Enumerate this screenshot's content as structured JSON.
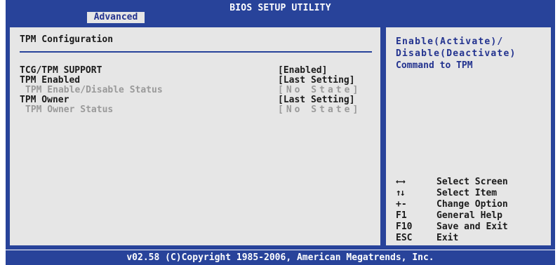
{
  "header": {
    "title": "BIOS SETUP UTILITY",
    "active_tab": "Advanced"
  },
  "main": {
    "section_title": "TPM Configuration",
    "items": [
      {
        "label": "TCG/TPM SUPPORT",
        "value": "[Enabled]",
        "dim": false
      },
      {
        "label": "TPM Enabled",
        "value": "[Last Setting]",
        "dim": false
      },
      {
        "label": "TPM Enable/Disable Status",
        "value": "[No State]",
        "dim": true
      },
      {
        "label": "TPM Owner",
        "value": "[Last Setting]",
        "dim": false
      },
      {
        "label": "TPM Owner Status",
        "value": "[No State]",
        "dim": true
      }
    ]
  },
  "help": {
    "line1": "Enable(Activate)/",
    "line2": "Disable(Deactivate)",
    "line3": "Command to TPM"
  },
  "keys": [
    {
      "key": "←→",
      "desc": "Select Screen"
    },
    {
      "key": "↑↓",
      "desc": "Select Item"
    },
    {
      "key": "+-",
      "desc": "Change Option"
    },
    {
      "key": "F1",
      "desc": "General Help"
    },
    {
      "key": "F10",
      "desc": "Save and Exit"
    },
    {
      "key": "ESC",
      "desc": "Exit"
    }
  ],
  "footer": {
    "text": "v02.58 (C)Copyright 1985-2006, American Megatrends, Inc."
  }
}
